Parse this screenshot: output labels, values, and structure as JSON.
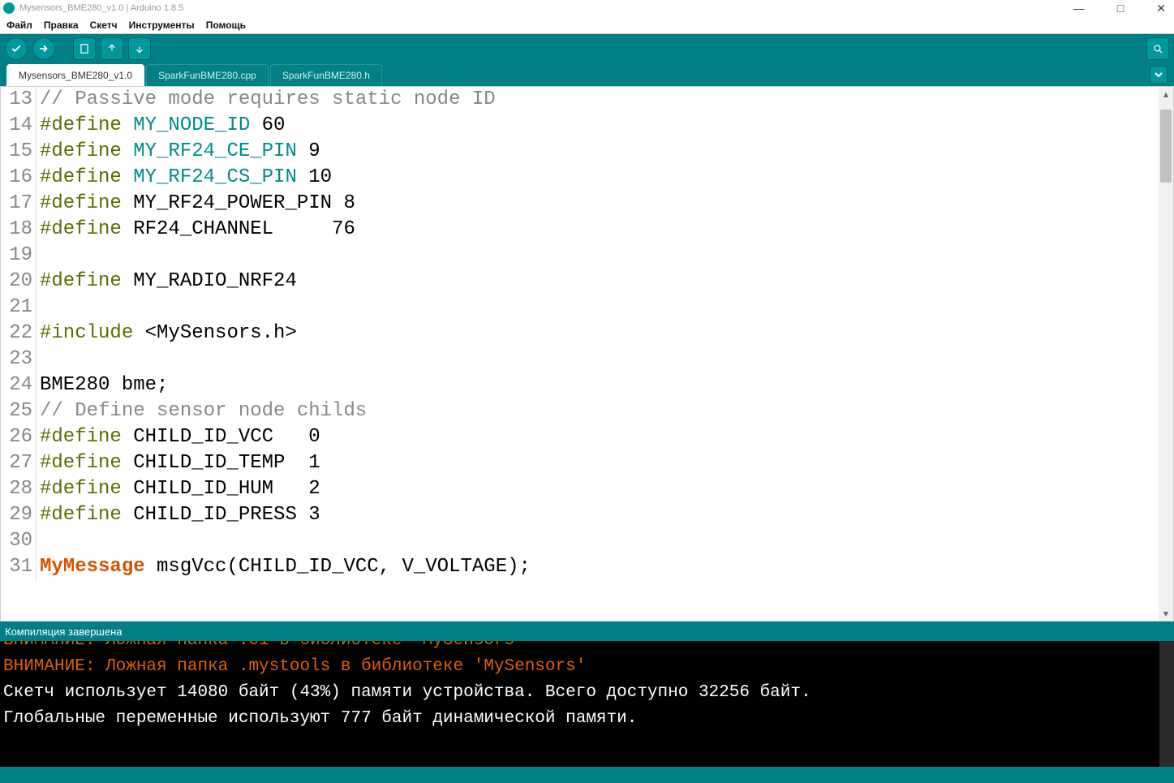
{
  "window": {
    "title": "Mysensors_BME280_v1.0 | Arduino 1.8.5",
    "minimize": "—",
    "maximize": "□",
    "close": "✕"
  },
  "menu": {
    "file": "Файл",
    "edit": "Правка",
    "sketch": "Скетч",
    "tools": "Инструменты",
    "help": "Помощь"
  },
  "tabs": {
    "active": "Mysensors_BME280_v1.0",
    "t1": "SparkFunBME280.cpp",
    "t2": "SparkFunBME280.h"
  },
  "code": {
    "lines": [
      {
        "n": "13",
        "pp": "",
        "m": "",
        "t": "// Passive mode requires static node ID",
        "cls": "comment"
      },
      {
        "n": "14",
        "pp": "#define ",
        "m": "MY_NODE_ID",
        "t": " 60"
      },
      {
        "n": "15",
        "pp": "#define ",
        "m": "MY_RF24_CE_PIN",
        "t": " 9"
      },
      {
        "n": "16",
        "pp": "#define ",
        "m": "MY_RF24_CS_PIN",
        "t": " 10"
      },
      {
        "n": "17",
        "pp": "#define ",
        "m": "",
        "t": "MY_RF24_POWER_PIN 8"
      },
      {
        "n": "18",
        "pp": "#define ",
        "m": "",
        "t": "RF24_CHANNEL     76"
      },
      {
        "n": "19",
        "pp": "",
        "m": "",
        "t": ""
      },
      {
        "n": "20",
        "pp": "#define ",
        "m": "",
        "t": "MY_RADIO_NRF24"
      },
      {
        "n": "21",
        "pp": "",
        "m": "",
        "t": ""
      },
      {
        "n": "22",
        "pp": "#include ",
        "m": "",
        "t": "<MySensors.h>"
      },
      {
        "n": "23",
        "pp": "",
        "m": "",
        "t": ""
      },
      {
        "n": "24",
        "pp": "",
        "m": "",
        "t": "BME280 bme;"
      },
      {
        "n": "25",
        "pp": "",
        "m": "",
        "t": "// Define sensor node childs",
        "cls": "comment"
      },
      {
        "n": "26",
        "pp": "#define ",
        "m": "",
        "t": "CHILD_ID_VCC   0"
      },
      {
        "n": "27",
        "pp": "#define ",
        "m": "",
        "t": "CHILD_ID_TEMP  1"
      },
      {
        "n": "28",
        "pp": "#define ",
        "m": "",
        "t": "CHILD_ID_HUM   2"
      },
      {
        "n": "29",
        "pp": "#define ",
        "m": "",
        "t": "CHILD_ID_PRESS 3"
      },
      {
        "n": "30",
        "pp": "",
        "m": "",
        "t": ""
      },
      {
        "n": "31",
        "pp": "",
        "m": "",
        "t": "",
        "type": "MyMessage",
        "rest": " msgVcc(CHILD_ID_VCC, V_VOLTAGE);"
      }
    ]
  },
  "status": "Компиляция завершена",
  "console": {
    "l0": "ВНИМАНИЕ: Ложная папка .ci в библиотеке 'MySensors'",
    "l1": "ВНИМАНИЕ: Ложная папка .mystools в библиотеке 'MySensors'",
    "l2": "Скетч использует 14080 байт (43%) памяти устройства. Всего доступно 32256 байт.",
    "l3": "Глобальные переменные используют 777 байт динамической памяти."
  }
}
